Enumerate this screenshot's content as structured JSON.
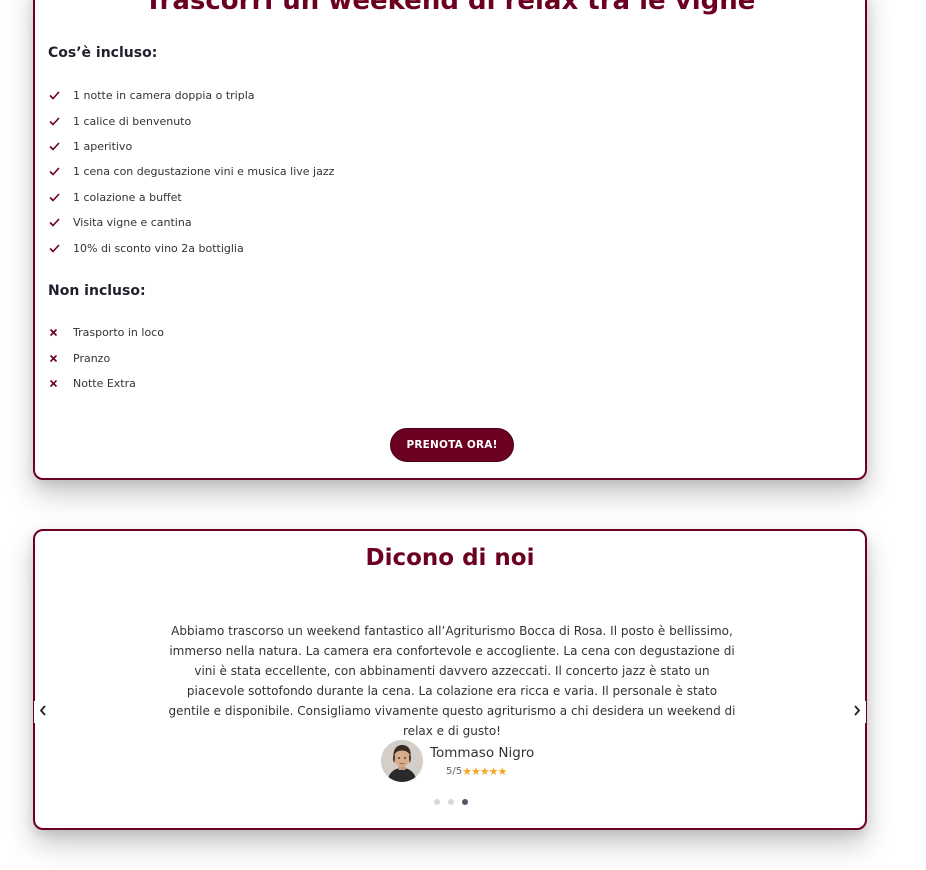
{
  "offer": {
    "title": "Trascorri un weekend di relax tra le vigne",
    "included_heading": "Cos’è incluso:",
    "included_items": [
      "1 notte in camera doppia o tripla",
      "1 calice di benvenuto",
      "1 aperitivo",
      "1 cena con degustazione vini e musica live jazz",
      "1 colazione a buffet",
      "Visita vigne e cantina",
      "10% di sconto vino 2a bottiglia"
    ],
    "excluded_heading": "Non incluso:",
    "excluded_items": [
      "Trasporto in loco",
      "Pranzo",
      "Notte Extra"
    ],
    "book_label": "PRENOTA ORA!"
  },
  "reviews": {
    "title": "Dicono di noi",
    "text": "Abbiamo trascorso un weekend fantastico all’Agriturismo Bocca di Rosa. Il posto è bellissimo, immerso nella natura. La camera era confortevole e accogliente. La cena con degustazione di vini è stata eccellente, con abbinamenti davvero azzeccati. Il concerto jazz è stato un piacevole sottofondo durante la cena. La colazione era ricca e varia. Il personale è stato gentile e disponibile. Consigliamo vivamente questo agriturismo a chi desidera un weekend di relax e di gusto!",
    "author": "Tommaso Nigro",
    "rating_label": "5/5",
    "rating_value": 5,
    "rating_max": 5,
    "stars": "★★★★★",
    "prev_icon": "chevron-left-icon",
    "next_icon": "chevron-right-icon",
    "slides_count": 3,
    "active_slide": 3
  },
  "colors": {
    "accent": "#6b0020",
    "star": "#f5a623"
  }
}
